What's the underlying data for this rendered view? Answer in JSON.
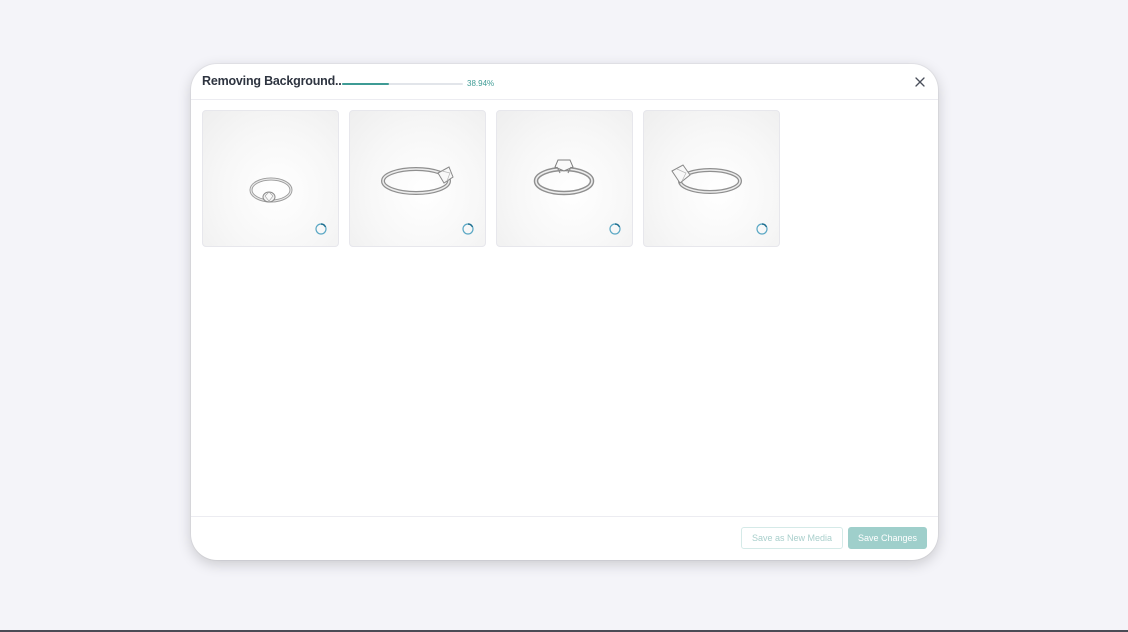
{
  "dialog": {
    "title": "Removing Background...",
    "progress": {
      "percent": 38.94,
      "label": "38.94%"
    },
    "close_icon": "close-icon"
  },
  "thumbnails": [
    {
      "subject": "ring-top-angle",
      "status_icon": "loading-spinner-icon"
    },
    {
      "subject": "ring-side-left",
      "status_icon": "loading-spinner-icon"
    },
    {
      "subject": "ring-front",
      "status_icon": "loading-spinner-icon"
    },
    {
      "subject": "ring-side-right",
      "status_icon": "loading-spinner-icon"
    }
  ],
  "footer": {
    "save_as_new_label": "Save as New Media",
    "save_changes_label": "Save Changes"
  },
  "colors": {
    "accent": "#3e9b95",
    "primary_button_disabled": "#9fcfcb",
    "title_text": "#2e3440"
  }
}
